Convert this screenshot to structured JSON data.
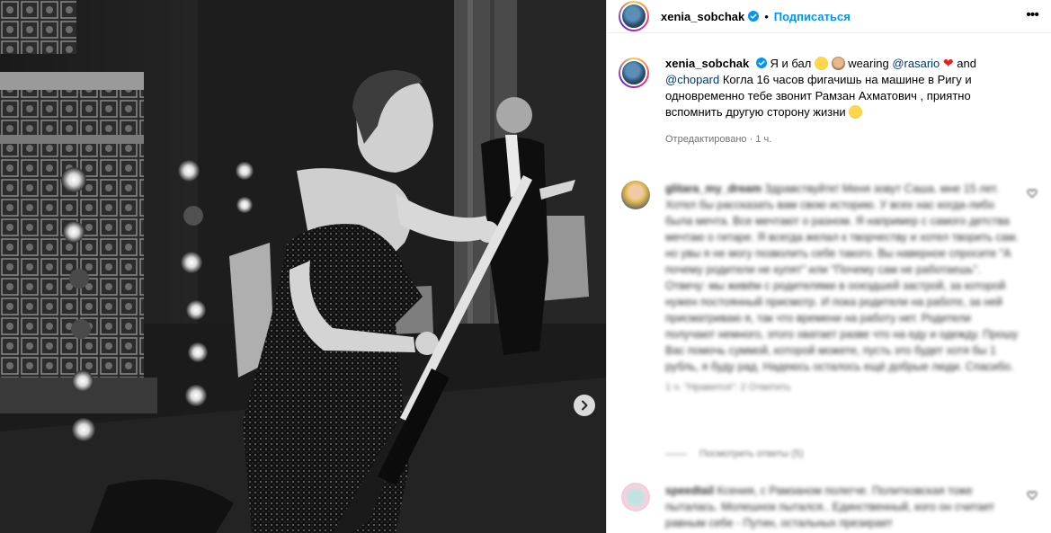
{
  "post": {
    "username": "xenia_sobchak",
    "follow_label": "Подписаться",
    "separator": "•",
    "more_label": "•••"
  },
  "caption": {
    "username": "xenia_sobchak",
    "text_start": "Я и бал",
    "wearing": "wearing",
    "mention1": "@rasario",
    "and": "and",
    "mention2": "@chopard",
    "body": "Когла 16 часов фигачишь на машине в Ригу и одновременно тебе звонит Рамзан Ахматович , приятно вспомнить другую сторону жизни",
    "edited": "Отредактировано",
    "time": "1 ч."
  },
  "comments": [
    {
      "username": "glitara_my_dream",
      "text": "Здравствуйте! Меня зовут Саша. мне 15 лет. Хотел бы рассказать вам свою историю. У всех нас когда-либо была мечта. Все мечтают о разном. Я например с самого детства мечтаю о гитаре. Я всегда желал к творчеству и хотел творить сам. но увы я не могу позволить себе такого. Вы наверное спросите \"А почему родители не купят\" или \"Почему сам не работаешь\". Отвечу: мы живём с родителями в ооездшей застрой, за которой нужен постоянный присмотр. И пока родители на работе, за ней присматриваю я, так что времени на работу нет. Родители получают немного, этого хватает разве что на еду и одежду. Прошу Вас помочь суммой, которой можете, пусть это будет хотя бы 1 рубль, я буду рад. Надеюсь осталось ещё добрые люди. Спасибо.",
      "meta": "1 ч.   \"Нравится\": 2   Ответить",
      "replies": "Посмотреть ответы (5)"
    },
    {
      "username": "speedtail",
      "text": "Ксения, с Рамзаном полегче. Политковская тоже пыталась. Молешнок пытался.. Единственный, кого он считает равным себе - Путин, остальных презирает"
    }
  ],
  "colors": {
    "accent": "#0095f6",
    "mention": "#00376b",
    "verified": "#0095f6",
    "heart": "#ed1c24"
  },
  "icons": {
    "verified": "verified-badge-icon",
    "more": "more-options-icon",
    "next": "chevron-right-icon",
    "heart": "heart-icon"
  }
}
